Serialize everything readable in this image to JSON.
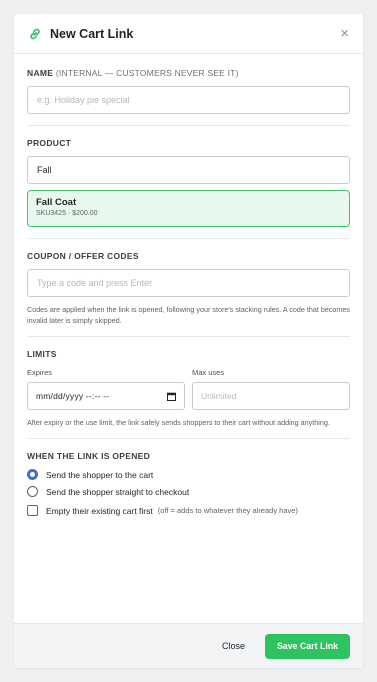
{
  "header": {
    "title": "New Cart Link",
    "close_label": "×"
  },
  "name_section": {
    "label": "NAME",
    "sublabel": "(INTERNAL — CUSTOMERS NEVER SEE IT)",
    "placeholder": "e.g. Holiday pie special",
    "value": ""
  },
  "product_section": {
    "label": "PRODUCT",
    "search_value": "Fall",
    "result": {
      "name": "Fall Coat",
      "meta": "SKU3425 · $200.00"
    }
  },
  "coupon_section": {
    "label": "COUPON / OFFER CODES",
    "placeholder": "Type a code and press Enter",
    "help": "Codes are applied when the link is opened, following your store's stacking rules. A code that becomes invalid later is simply skipped."
  },
  "limits_section": {
    "label": "LIMITS",
    "expires_label": "Expires",
    "expires_value": "mm/dd/yyyy --:-- --",
    "max_uses_label": "Max uses",
    "max_uses_placeholder": "Unlimited",
    "help": "After expiry or the use limit, the link safely sends shoppers to their cart without adding anything."
  },
  "open_section": {
    "label": "WHEN THE LINK IS OPENED",
    "options": [
      {
        "label": "Send the shopper to the cart",
        "checked": true
      },
      {
        "label": "Send the shopper straight to checkout",
        "checked": false
      }
    ],
    "empty_cart_label": "Empty their existing cart first",
    "empty_cart_hint": "(off = adds to whatever they already have)",
    "empty_cart_checked": false
  },
  "footer": {
    "close_label": "Close",
    "save_label": "Save Cart Link"
  },
  "colors": {
    "accent_green": "#2ec361",
    "card_green_bg": "#e7f8ec",
    "card_green_border": "#45c56b",
    "radio_blue": "#3b6fd8"
  }
}
